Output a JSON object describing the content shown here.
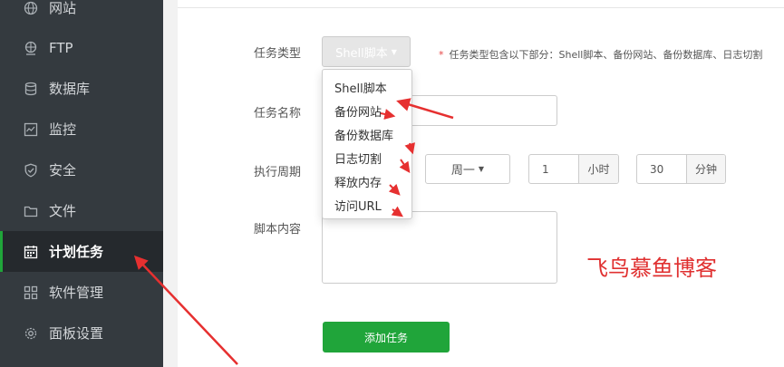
{
  "sidebar": {
    "items": [
      {
        "label": "网站",
        "icon": "globe-icon"
      },
      {
        "label": "FTP",
        "icon": "ftp-globe-icon"
      },
      {
        "label": "数据库",
        "icon": "database-icon"
      },
      {
        "label": "监控",
        "icon": "monitor-icon"
      },
      {
        "label": "安全",
        "icon": "shield-icon"
      },
      {
        "label": "文件",
        "icon": "folder-icon"
      },
      {
        "label": "计划任务",
        "icon": "calendar-icon",
        "active": true
      },
      {
        "label": "软件管理",
        "icon": "grid-icon"
      },
      {
        "label": "面板设置",
        "icon": "gear-icon"
      }
    ]
  },
  "form": {
    "task_type_label": "任务类型",
    "task_type_value": "Shell脚本",
    "task_type_hint_star": "*",
    "task_type_hint": "任务类型包含以下部分：Shell脚本、备份网站、备份数据库、日志切割",
    "task_name_label": "任务名称",
    "task_name_value": "",
    "period_label": "执行周期",
    "period_week": "周一",
    "period_hour_value": "1",
    "period_hour_unit": "小时",
    "period_minute_value": "30",
    "period_minute_unit": "分钟",
    "script_label": "脚本内容",
    "script_value": "",
    "submit_label": "添加任务"
  },
  "dropdown": {
    "options": [
      "Shell脚本",
      "备份网站",
      "备份数据库",
      "日志切割",
      "释放内存",
      "访问URL"
    ]
  },
  "watermark": "飞鸟慕鱼博客",
  "colors": {
    "sidebar_bg": "#343a3f",
    "accent_green": "#20a53a",
    "annotation_red": "#e63030"
  }
}
